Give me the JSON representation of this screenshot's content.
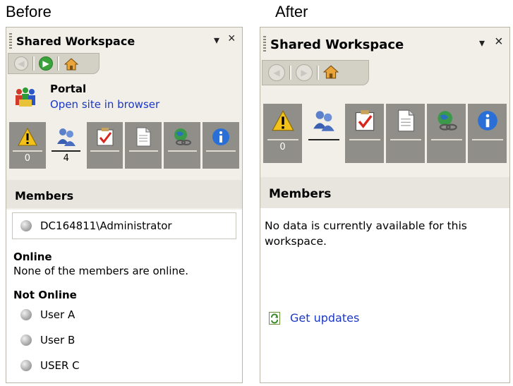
{
  "captions": {
    "before": "Before",
    "after": "After"
  },
  "panel": {
    "title": "Shared Workspace",
    "dropdown_glyph": "▾",
    "close_glyph": "×"
  },
  "before": {
    "portal": {
      "name": "Portal",
      "link": "Open site in browser"
    },
    "tabs": [
      {
        "icon": "warning-icon",
        "count": "0"
      },
      {
        "icon": "members-icon",
        "count": "4",
        "selected": true
      },
      {
        "icon": "tasks-icon",
        "count": ""
      },
      {
        "icon": "documents-icon",
        "count": ""
      },
      {
        "icon": "links-icon",
        "count": ""
      },
      {
        "icon": "info-icon",
        "count": ""
      }
    ],
    "section": "Members",
    "current_user": "DC164811\\Administrator",
    "online_heading": "Online",
    "online_text": "None of the members are online.",
    "offline_heading": "Not Online",
    "offline_members": [
      "User A",
      "User B",
      "USER C"
    ]
  },
  "after": {
    "tabs": [
      {
        "icon": "warning-icon",
        "count": "0"
      },
      {
        "icon": "members-icon",
        "count": "",
        "selected": true
      },
      {
        "icon": "tasks-icon",
        "count": ""
      },
      {
        "icon": "documents-icon",
        "count": ""
      },
      {
        "icon": "links-icon",
        "count": ""
      },
      {
        "icon": "info-icon",
        "count": ""
      }
    ],
    "section": "Members",
    "message_line1": "No data is currently available for this",
    "message_line2": "workspace.",
    "get_updates": "Get updates"
  },
  "colors": {
    "link": "#1a37c8",
    "tab_bg": "#8f8e89",
    "panel_bg": "#f1efe7"
  }
}
